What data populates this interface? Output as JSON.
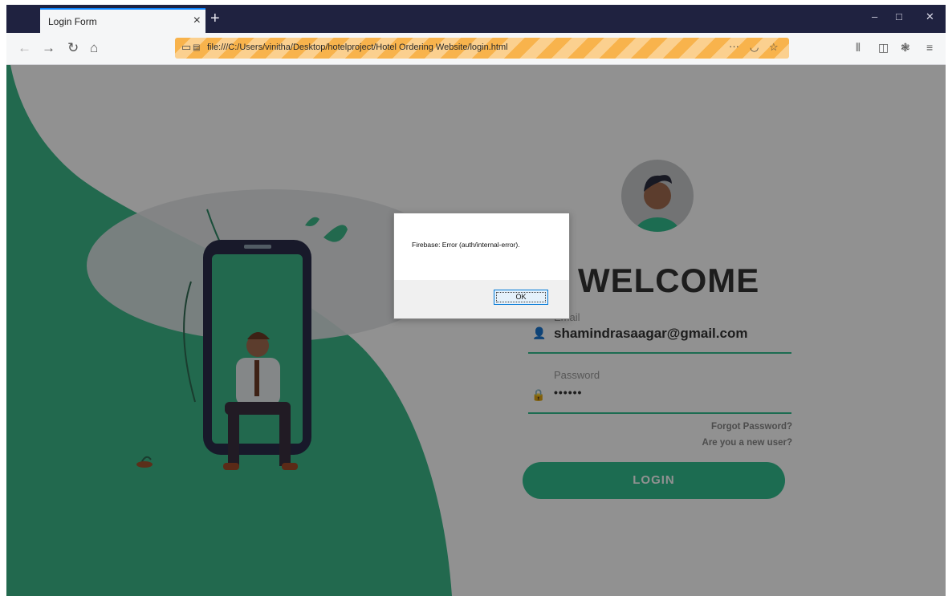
{
  "browser": {
    "tab_title": "Login Form",
    "tab_close": "×",
    "new_tab": "+",
    "url": "file:///C:/Users/vinitha/Desktop/hotelproject/Hotel Ordering Website/login.html",
    "page_actions": "···",
    "window_controls": {
      "minimize": "–",
      "maximize": "□",
      "close": "✕"
    }
  },
  "form": {
    "heading": "WELCOME",
    "email_label": "Email",
    "email_value": "shamindrasaagar@gmail.com",
    "password_label": "Password",
    "password_value": "••••••",
    "forgot_link": "Forgot Password?",
    "new_user_link": "Are you a new user?",
    "login_button": "LOGIN"
  },
  "dialog": {
    "message": "Firebase: Error (auth/internal-error).",
    "ok_label": "OK"
  },
  "colors": {
    "accent": "#32be8f",
    "browser_chrome": "#1f2240",
    "url_highlight": "#f8b34c"
  },
  "icons": [
    "back-icon",
    "forward-icon",
    "reload-icon",
    "home-icon",
    "page-icon",
    "bookmark-star-icon",
    "pocket-icon",
    "library-icon",
    "sidebar-icon",
    "extension-icon",
    "menu-icon",
    "user-icon",
    "lock-icon"
  ]
}
